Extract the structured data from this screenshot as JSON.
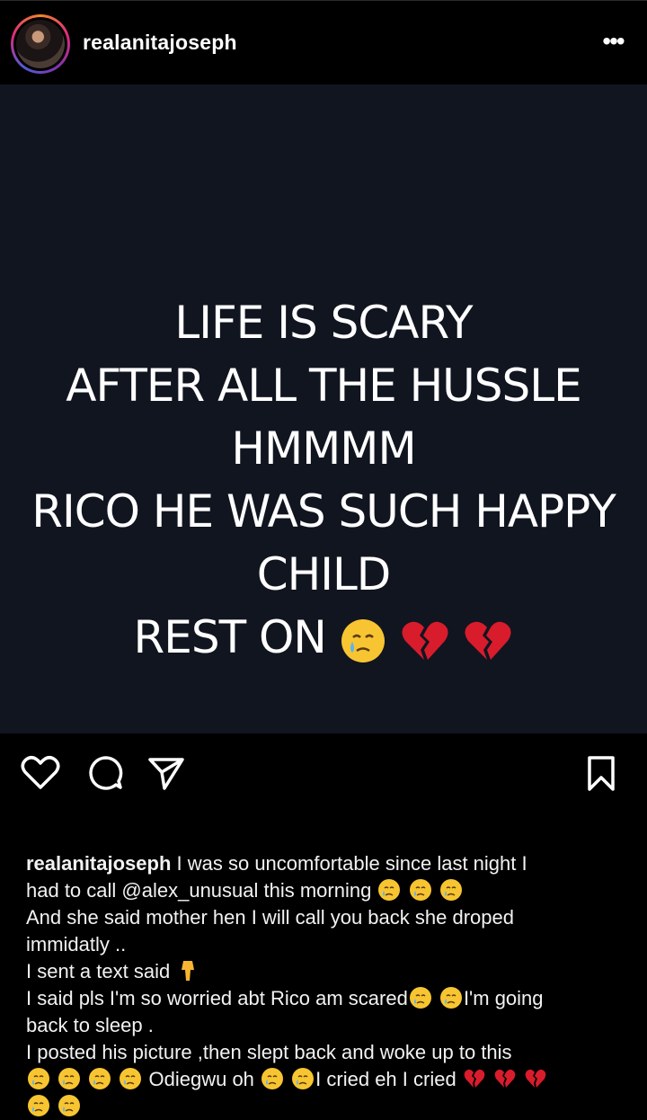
{
  "post": {
    "username": "realanitajoseph",
    "more_label": "•••",
    "image_text_lines": [
      "LIFE IS SCARY",
      "AFTER ALL THE HUSSLE",
      "HMMMM",
      "RICO HE WAS SUCH HAPPY",
      "CHILD",
      "REST ON"
    ],
    "image_emojis": [
      "crying-face",
      "broken-heart",
      "broken-heart"
    ],
    "colors": {
      "image_bg": "#111520",
      "page_bg": "#000000",
      "text": "#ffffff"
    }
  },
  "actions": {
    "like_icon": "heart-icon",
    "comment_icon": "comment-icon",
    "share_icon": "send-icon",
    "save_icon": "bookmark-icon"
  },
  "caption": {
    "username": "realanitajoseph",
    "line1": "I was so uncomfortable since last night I",
    "line2": "had to call @alex_unusual this morning",
    "line3": "And she said mother hen I will call you back she droped",
    "line4": "immidatly ..",
    "line5": "I sent a text said",
    "line6a": "I said pls I'm so worried abt Rico am scared",
    "line6b": "I'm going",
    "line7": "back to sleep .",
    "line8": "I posted his picture ,then slept  back and woke up to this",
    "line9a": "Odiegwu oh",
    "line9b": "I cried eh I cried"
  }
}
